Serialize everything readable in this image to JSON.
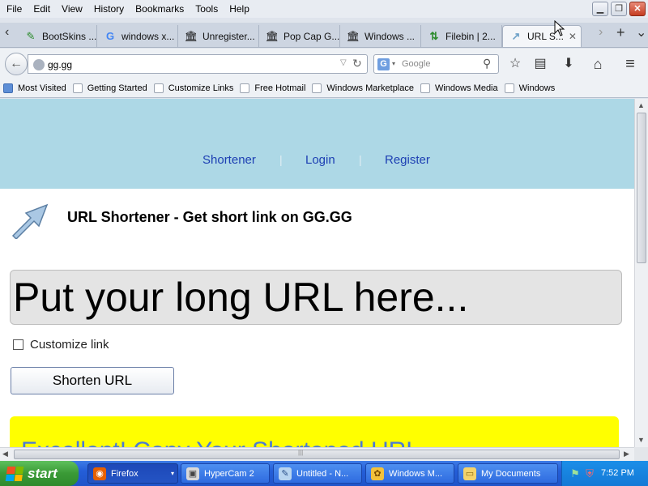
{
  "menu": [
    "File",
    "Edit",
    "View",
    "History",
    "Bookmarks",
    "Tools",
    "Help"
  ],
  "window_controls": {
    "minimize": "▁",
    "restore": "❐",
    "close": "✕"
  },
  "tabs": [
    {
      "label": "BootSkins ...",
      "icon": "bootskins-icon",
      "glyph": "✎",
      "color": "#2c8b2c",
      "active": false
    },
    {
      "label": "windows x...",
      "icon": "google-icon",
      "glyph": "G",
      "color": "#4285f4",
      "active": false
    },
    {
      "label": "Unregister...",
      "icon": "museum-icon",
      "glyph": "🏛",
      "color": "#333333",
      "active": false
    },
    {
      "label": "Pop Cap G...",
      "icon": "museum-icon",
      "glyph": "🏛",
      "color": "#333333",
      "active": false
    },
    {
      "label": "Windows ...",
      "icon": "museum-icon",
      "glyph": "🏛",
      "color": "#333333",
      "active": false
    },
    {
      "label": "Filebin | 2...",
      "icon": "filebin-icon",
      "glyph": "⇅",
      "color": "#2c8b2c",
      "active": false
    },
    {
      "label": "URL S...",
      "icon": "arrow-icon",
      "glyph": "↗",
      "color": "#6fa2c8",
      "active": true
    }
  ],
  "tab_close": "✕",
  "tab_scroll_left": "‹",
  "tab_scroll_right": "›",
  "new_tab": "+",
  "tab_list": "⌄",
  "nav": {
    "back": "←",
    "url": "gg.gg",
    "url_dropdown": "▽",
    "reload": "↻",
    "search_engine": "G",
    "search_dropdown": "▾",
    "search_placeholder": "Google",
    "search_go": "⚲",
    "bookmark_star": "☆",
    "reader": "▤",
    "downloads": "⬇",
    "home": "⌂",
    "menu": "≡"
  },
  "bookmarks": [
    "Most Visited",
    "Getting Started",
    "Customize Links",
    "Free Hotmail",
    "Windows Marketplace",
    "Windows Media",
    "Windows"
  ],
  "site": {
    "nav": [
      "Shortener",
      "Login",
      "Register"
    ],
    "nav_sep": "|",
    "title": "URL Shortener - Get short link on GG.GG",
    "url_placeholder": "Put your long URL here...",
    "customize_label": "Customize link",
    "shorten_button": "Shorten URL",
    "result_text": "Excellent! Copy Your Shortened URL"
  },
  "scroll": {
    "up": "▲",
    "down": "▼",
    "left": "◀",
    "right": "▶",
    "grip": "|||"
  },
  "taskbar": {
    "start": "start",
    "tasks": [
      {
        "label": "Firefox",
        "icon": "firefox-icon",
        "glyph": "◉",
        "color": "#e66000",
        "active": true,
        "dropdown": true
      },
      {
        "label": "HyperCam 2",
        "icon": "hypercam-icon",
        "glyph": "▣",
        "color": "#d9d9d9",
        "active": false,
        "dropdown": false
      },
      {
        "label": "Untitled - N...",
        "icon": "notepad-icon",
        "glyph": "✎",
        "color": "#b8d4f0",
        "active": false,
        "dropdown": false
      },
      {
        "label": "Windows M...",
        "icon": "windows-media-icon",
        "glyph": "✿",
        "color": "#f3c23b",
        "active": false,
        "dropdown": false
      },
      {
        "label": "My Documents",
        "icon": "folder-icon",
        "glyph": "▭",
        "color": "#f4d36b",
        "active": false,
        "dropdown": false
      }
    ],
    "tray_icons": [
      {
        "icon": "network-icon",
        "glyph": "⚑"
      },
      {
        "icon": "security-shield-icon",
        "glyph": "⛨"
      }
    ],
    "clock": "7:52 PM"
  }
}
